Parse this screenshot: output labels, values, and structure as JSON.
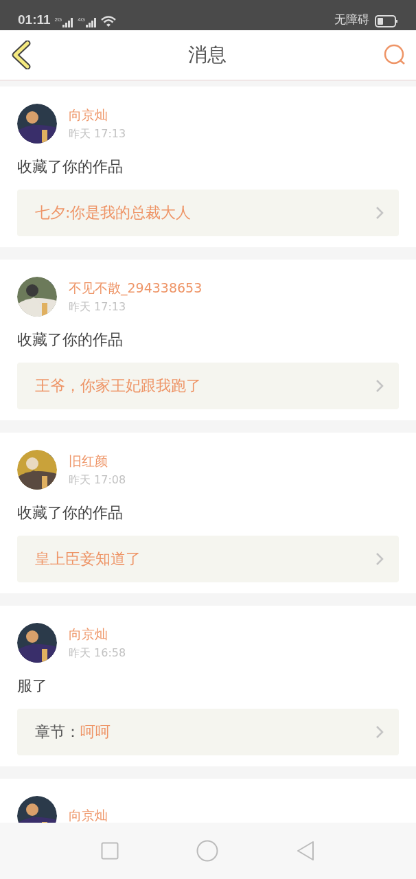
{
  "status_bar": {
    "time": "01:11",
    "network_1": "2G",
    "network_2": "4G",
    "accessibility": "无障碍"
  },
  "header": {
    "title": "消息"
  },
  "messages": [
    {
      "name": "向京灿",
      "time": "昨天 17:13",
      "text": "收藏了你的作品",
      "link": {
        "kind": "work",
        "title": "七夕:你是我的总裁大人"
      }
    },
    {
      "name": "不见不散_294338653",
      "time": "昨天 17:13",
      "text": "收藏了你的作品",
      "link": {
        "kind": "work",
        "title": "王爷，你家王妃跟我跑了"
      }
    },
    {
      "name": "旧红颜",
      "time": "昨天 17:08",
      "text": "收藏了你的作品",
      "link": {
        "kind": "work",
        "title": "皇上臣妾知道了"
      }
    },
    {
      "name": "向京灿",
      "time": "昨天 16:58",
      "text": "服了",
      "link": {
        "kind": "chapter",
        "label": "章节：",
        "title": "呵呵"
      }
    },
    {
      "name": "向京灿"
    }
  ]
}
